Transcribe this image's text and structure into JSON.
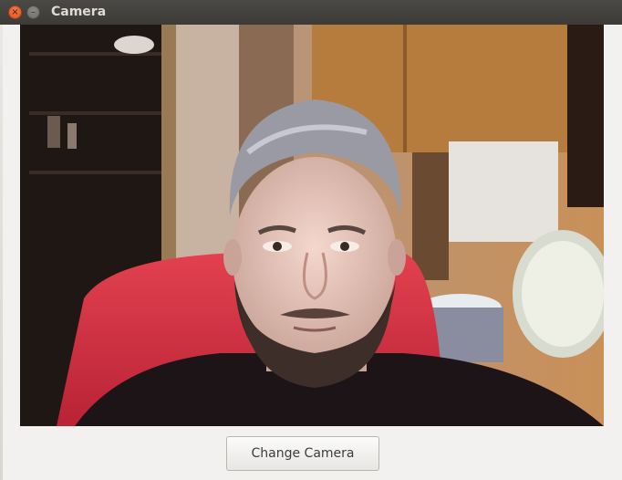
{
  "window": {
    "title": "Camera",
    "close_glyph": "×",
    "minimize_glyph": "–"
  },
  "camera": {
    "feed_content": "webcam-view"
  },
  "controls": {
    "change_camera_label": "Change Camera"
  },
  "colors": {
    "titlebar": "#3c3b37",
    "window_bg": "#f2f1f0",
    "close_button": "#e0541f"
  }
}
